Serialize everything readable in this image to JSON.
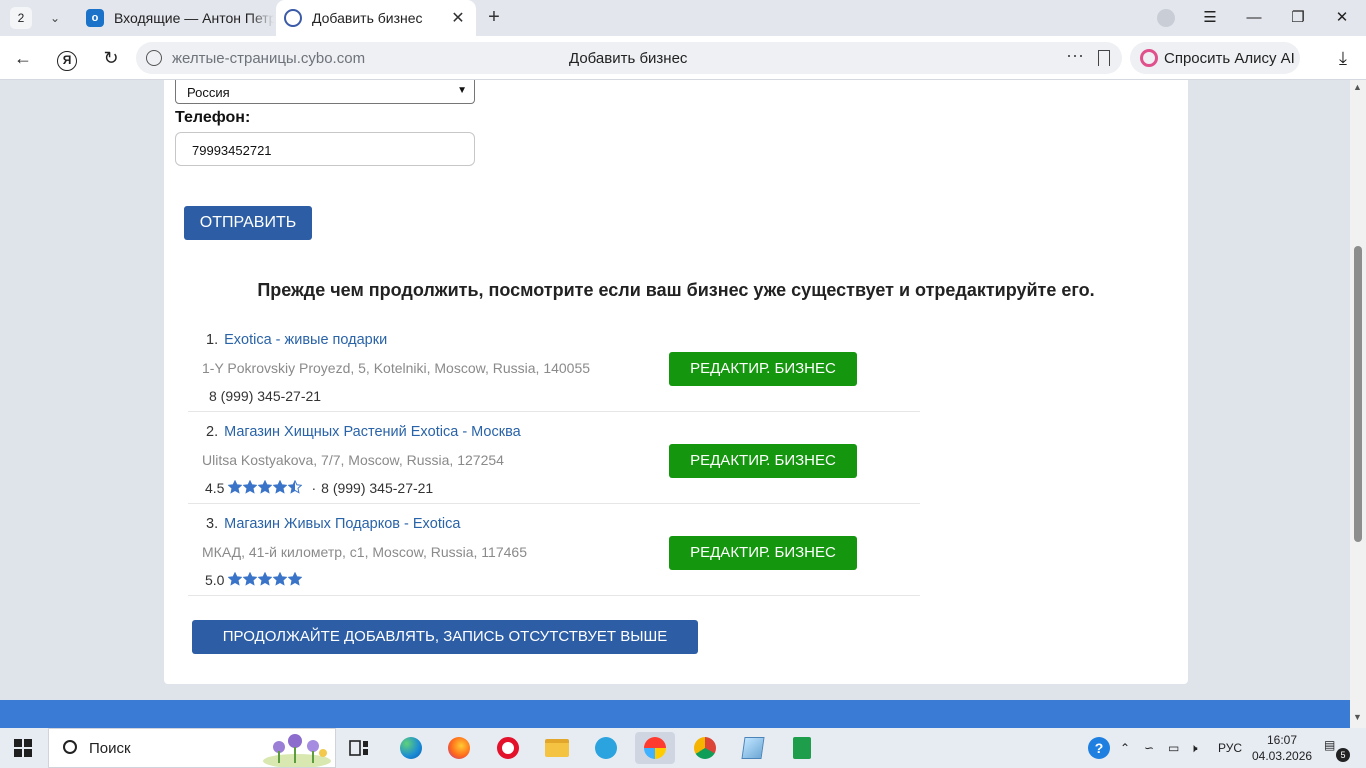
{
  "browser": {
    "tab_count": "2",
    "tabs": [
      {
        "title": "Входящие — Антон Петров",
        "active": false
      },
      {
        "title": "Добавить бизнес",
        "active": true
      }
    ],
    "url": "желтые-страницы.cybo.com",
    "page_title": "Добавить бизнес",
    "alice_label": "Спросить Алису AI"
  },
  "form": {
    "country_value": "Россия",
    "phone_label": "Телефон:",
    "phone_value": "79993452721",
    "submit_label": "ОТПРАВИТЬ"
  },
  "notice": "Прежде чем продолжить, посмотрите если ваш бизнес уже существует и отредактируйте его.",
  "results": [
    {
      "index": "1.",
      "name": "Exotica - живые подарки",
      "address": "1-Y Pokrovskiy Proyezd, 5, Kotelniki, Moscow, Russia, 140055",
      "rating": "",
      "stars": 0,
      "phone": "8 (999) 345-27-21",
      "edit_label": "РЕДАКТИР. БИЗНЕС"
    },
    {
      "index": "2.",
      "name": "Магазин Хищных Растений Exotica - Москва",
      "address": "Ulitsa Kostyakova, 7/7, Moscow, Russia, 127254",
      "rating": "4.5",
      "stars": 4.5,
      "separator": "·",
      "phone": "8 (999) 345-27-21",
      "edit_label": "РЕДАКТИР. БИЗНЕС"
    },
    {
      "index": "3.",
      "name": "Магазин Живых Подарков - Exotica",
      "address": "МКАД, 41-й километр, с1, Moscow, Russia, 117465",
      "rating": "5.0",
      "stars": 5,
      "phone": "",
      "edit_label": "РЕДАКТИР. БИЗНЕС"
    }
  ],
  "continue_label": "ПРОДОЛЖАЙТЕ ДОБАВЛЯТЬ, ЗАПИСЬ ОТСУТСТВУЕТ ВЫШЕ",
  "taskbar": {
    "search_placeholder": "Поиск",
    "language": "РУС",
    "time": "16:07",
    "date": "04.03.2026",
    "notifications_count": "5",
    "apps": [
      "task-view",
      "edge",
      "firefox",
      "opera",
      "file-explorer",
      "telegram",
      "yandex-browser",
      "chrome",
      "notes",
      "sheets"
    ]
  },
  "colors": {
    "link": "#2963a8",
    "primary_button": "#2d5ea5",
    "edit_button": "#14960e",
    "star": "#3a74c9",
    "footer_band": "#3a7bd5"
  }
}
